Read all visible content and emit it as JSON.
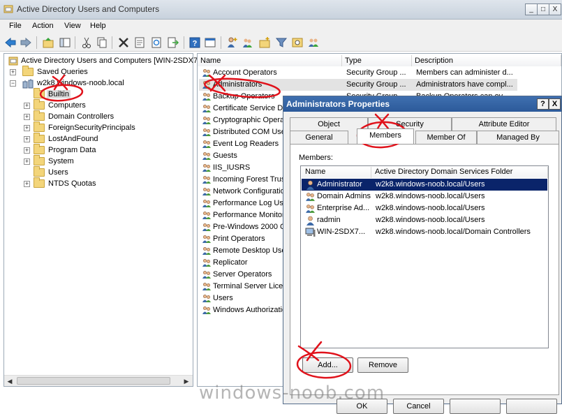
{
  "window": {
    "title": "Active Directory Users and Computers"
  },
  "menu": [
    "File",
    "Action",
    "View",
    "Help"
  ],
  "window_controls": {
    "minimize": "_",
    "maximize": "□",
    "close": "X"
  },
  "tree": {
    "root": "Active Directory Users and Computers [WIN-2SDX7",
    "items": [
      {
        "label": "Saved Queries",
        "expandable": true
      },
      {
        "label": "w2k8.windows-noob.local",
        "expandable": true,
        "expanded": true
      },
      {
        "label": "Builtin",
        "expandable": false,
        "selected": true
      },
      {
        "label": "Computers",
        "expandable": true
      },
      {
        "label": "Domain Controllers",
        "expandable": true
      },
      {
        "label": "ForeignSecurityPrincipals",
        "expandable": true
      },
      {
        "label": "LostAndFound",
        "expandable": true
      },
      {
        "label": "Program Data",
        "expandable": true
      },
      {
        "label": "System",
        "expandable": true
      },
      {
        "label": "Users",
        "expandable": false
      },
      {
        "label": "NTDS Quotas",
        "expandable": true
      }
    ]
  },
  "list": {
    "columns": [
      "Name",
      "Type",
      "Description"
    ],
    "rows": [
      {
        "name": "Account Operators",
        "type": "Security Group ...",
        "description": "Members can administer d..."
      },
      {
        "name": "Administrators",
        "type": "Security Group ...",
        "description": "Administrators have compl...",
        "selected": true
      },
      {
        "name": "Backup Operators",
        "type": "Security Group ...",
        "description": "Backup Operators can ov..."
      },
      {
        "name": "Certificate Service DC",
        "type": "",
        "description": ""
      },
      {
        "name": "Cryptographic Opera",
        "type": "",
        "description": ""
      },
      {
        "name": "Distributed COM User",
        "type": "",
        "description": ""
      },
      {
        "name": "Event Log Readers",
        "type": "",
        "description": ""
      },
      {
        "name": "Guests",
        "type": "",
        "description": ""
      },
      {
        "name": "IIS_IUSRS",
        "type": "",
        "description": ""
      },
      {
        "name": "Incoming Forest Trus",
        "type": "",
        "description": ""
      },
      {
        "name": "Network Configuratio",
        "type": "",
        "description": ""
      },
      {
        "name": "Performance Log Use",
        "type": "",
        "description": ""
      },
      {
        "name": "Performance Monitor",
        "type": "",
        "description": ""
      },
      {
        "name": "Pre-Windows 2000 C",
        "type": "",
        "description": ""
      },
      {
        "name": "Print Operators",
        "type": "",
        "description": ""
      },
      {
        "name": "Remote Desktop User",
        "type": "",
        "description": ""
      },
      {
        "name": "Replicator",
        "type": "",
        "description": ""
      },
      {
        "name": "Server Operators",
        "type": "",
        "description": ""
      },
      {
        "name": "Terminal Server Licen",
        "type": "",
        "description": ""
      },
      {
        "name": "Users",
        "type": "",
        "description": ""
      },
      {
        "name": "Windows Authorization",
        "type": "",
        "description": ""
      }
    ]
  },
  "dialog": {
    "title": "Administrators Properties",
    "help_btn": "?",
    "close_btn": "X",
    "tabs_back": [
      "Object",
      "Security",
      "Attribute Editor"
    ],
    "tabs_front": [
      "General",
      "Members",
      "Member Of",
      "Managed By"
    ],
    "active_tab": "Members",
    "members_label": "Members:",
    "members_columns": [
      "Name",
      "Active Directory Domain Services Folder"
    ],
    "members": [
      {
        "name": "Administrator",
        "folder": "w2k8.windows-noob.local/Users",
        "kind": "user",
        "selected": true
      },
      {
        "name": "Domain Admins",
        "folder": "w2k8.windows-noob.local/Users",
        "kind": "group"
      },
      {
        "name": "Enterprise Ad...",
        "folder": "w2k8.windows-noob.local/Users",
        "kind": "group"
      },
      {
        "name": "radmin",
        "folder": "w2k8.windows-noob.local/Users",
        "kind": "user"
      },
      {
        "name": "WIN-2SDX7...",
        "folder": "w2k8.windows-noob.local/Domain Controllers",
        "kind": "computer"
      }
    ],
    "add_label": "Add...",
    "remove_label": "Remove",
    "ok_label": "OK",
    "cancel_label": "Cancel"
  },
  "watermark": "windows-noob.com",
  "colors": {
    "annotation": "#e0121b",
    "selection": "#0a246a",
    "titlebar": "#2c5a9a"
  }
}
